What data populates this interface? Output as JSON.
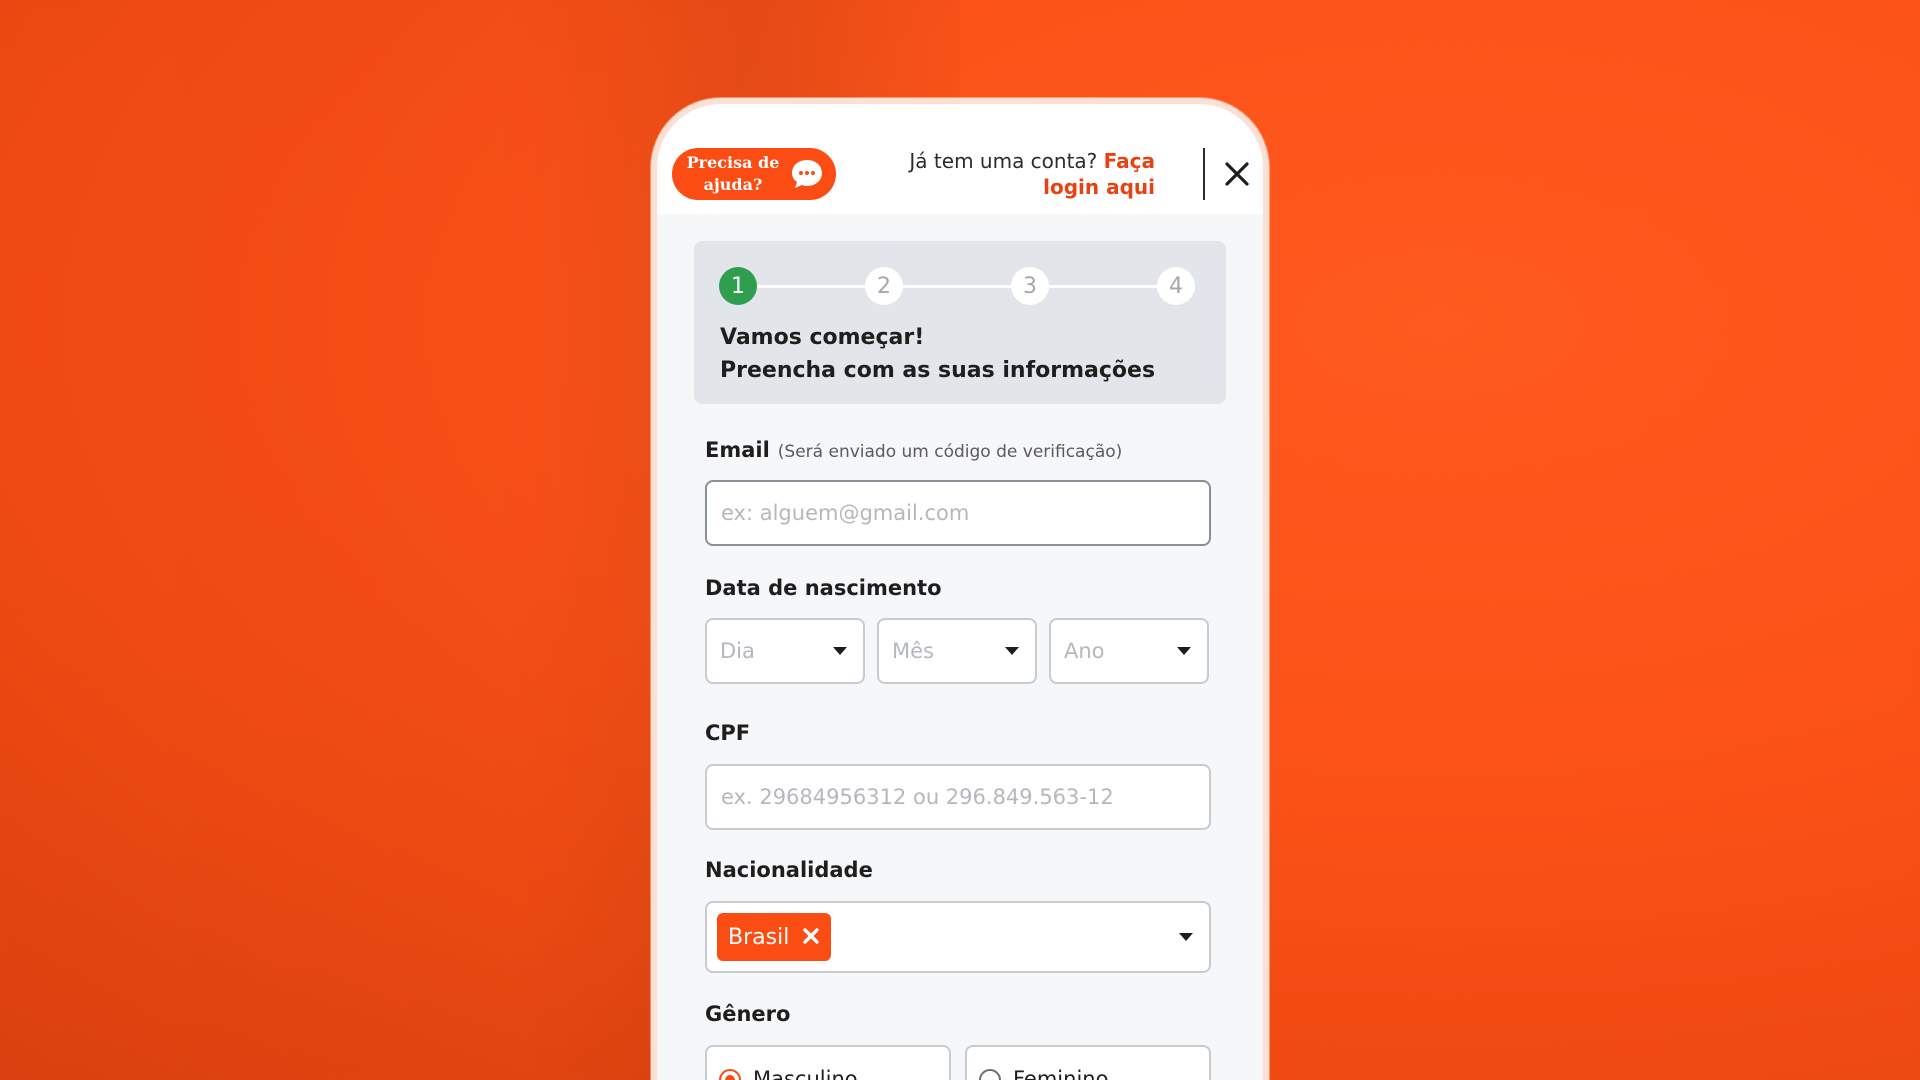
{
  "header": {
    "help_label": "Precisa de ajuda?",
    "account_prompt": "Já tem uma conta?",
    "login_link": "Faça login aqui"
  },
  "steps": {
    "items": [
      "1",
      "2",
      "3",
      "4"
    ],
    "active": 1,
    "title_line1": "Vamos começar!",
    "title_line2": "Preencha com as suas informações"
  },
  "form": {
    "email": {
      "label": "Email",
      "hint": "(Será enviado um código de verificação)",
      "placeholder": "ex: alguem@gmail.com"
    },
    "birthdate": {
      "label": "Data de nascimento",
      "day_placeholder": "Dia",
      "month_placeholder": "Mês",
      "year_placeholder": "Ano"
    },
    "cpf": {
      "label": "CPF",
      "placeholder": "ex. 29684956312 ou 296.849.563-12"
    },
    "nationality": {
      "label": "Nacionalidade",
      "selected": "Brasil"
    },
    "gender": {
      "label": "Gênero",
      "options": [
        "Masculino",
        "Feminino"
      ],
      "selected": "Masculino"
    }
  },
  "colors": {
    "brand": "#fb4c14",
    "step_active": "#2f9e4f",
    "background": "#fb5117"
  },
  "icons": {
    "help": "chat-bubble-icon",
    "close": "close-icon",
    "chip_remove": "x-icon",
    "dropdown": "caret-down-icon"
  }
}
